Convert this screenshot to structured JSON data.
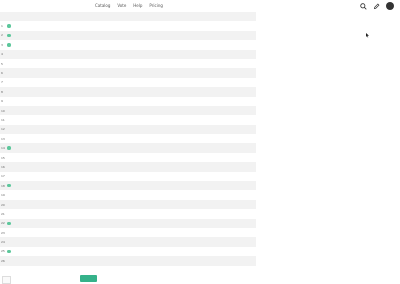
{
  "nav": {
    "items": [
      "Catalog",
      "Vote",
      "Help",
      "Pricing"
    ]
  },
  "rows": [
    {
      "idx": "",
      "label": "",
      "status": ""
    },
    {
      "idx": "1",
      "label": "",
      "status": "",
      "dot": "#5cc79b"
    },
    {
      "idx": "2",
      "label": "",
      "status": "",
      "dot": "#5cc79b"
    },
    {
      "idx": "3",
      "label": "",
      "status": "",
      "dot": "#5cc79b"
    },
    {
      "idx": "4",
      "label": "",
      "status": ""
    },
    {
      "idx": "5",
      "label": "",
      "status": ""
    },
    {
      "idx": "6",
      "label": "",
      "status": ""
    },
    {
      "idx": "7",
      "label": "",
      "status": ""
    },
    {
      "idx": "8",
      "label": "",
      "status": ""
    },
    {
      "idx": "9",
      "label": "",
      "status": ""
    },
    {
      "idx": "10",
      "label": "",
      "status": ""
    },
    {
      "idx": "11",
      "label": "",
      "status": ""
    },
    {
      "idx": "12",
      "label": "",
      "status": ""
    },
    {
      "idx": "13",
      "label": "",
      "status": ""
    },
    {
      "idx": "14",
      "label": "",
      "status": "",
      "dot": "#5cc79b"
    },
    {
      "idx": "15",
      "label": "",
      "status": ""
    },
    {
      "idx": "16",
      "label": "",
      "status": ""
    },
    {
      "idx": "17",
      "label": "",
      "status": ""
    },
    {
      "idx": "18",
      "label": "",
      "status": "",
      "dot": "#5cc79b"
    },
    {
      "idx": "19",
      "label": "",
      "status": "",
      "tag": ""
    },
    {
      "idx": "20",
      "label": "",
      "status": ""
    },
    {
      "idx": "21",
      "label": "",
      "status": ""
    },
    {
      "idx": "22",
      "label": "",
      "status": "",
      "dot": "#5cc79b"
    },
    {
      "idx": "23",
      "label": "",
      "status": ""
    },
    {
      "idx": "24",
      "label": "",
      "status": ""
    },
    {
      "idx": "25",
      "label": "",
      "status": "",
      "dot": "#5cc79b"
    },
    {
      "idx": "26",
      "label": "",
      "status": ""
    }
  ],
  "footer": {
    "note": "",
    "next_label": ""
  },
  "colors": {
    "accent": "#35b28a",
    "dot": "#5cc79b"
  }
}
